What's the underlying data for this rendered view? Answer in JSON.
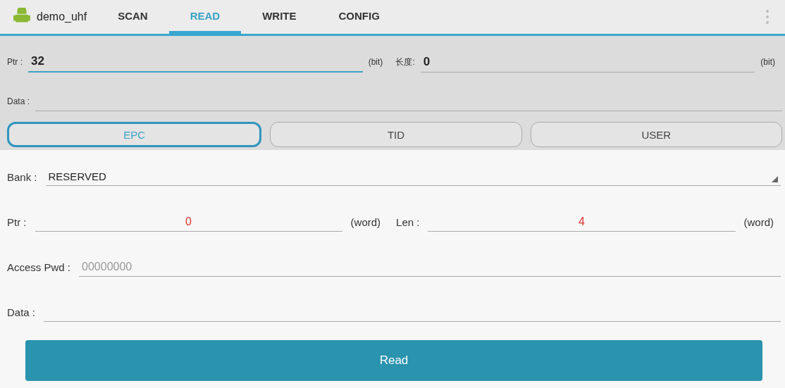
{
  "app": {
    "title": "demo_uhf"
  },
  "tabs": [
    {
      "label": "SCAN",
      "selected": false
    },
    {
      "label": "READ",
      "selected": true
    },
    {
      "label": "WRITE",
      "selected": false
    },
    {
      "label": "CONFIG",
      "selected": false
    }
  ],
  "top_form": {
    "ptr": {
      "label": "Ptr :",
      "value": "32",
      "unit": "(bit)"
    },
    "length": {
      "label": "长度:",
      "value": "0",
      "unit": "(bit)"
    },
    "data": {
      "label": "Data :"
    }
  },
  "bank_buttons": [
    {
      "label": "EPC",
      "selected": true
    },
    {
      "label": "TID",
      "selected": false
    },
    {
      "label": "USER",
      "selected": false
    }
  ],
  "bank": {
    "label": "Bank :",
    "value": "RESERVED"
  },
  "ptr": {
    "label": "Ptr :",
    "value": "0",
    "unit": "(word)"
  },
  "len": {
    "label": "Len :",
    "value": "4",
    "unit": "(word)"
  },
  "access_pwd": {
    "label": "Access Pwd :",
    "placeholder": "00000000"
  },
  "data": {
    "label": "Data :"
  },
  "read_button": {
    "label": "Read"
  }
}
